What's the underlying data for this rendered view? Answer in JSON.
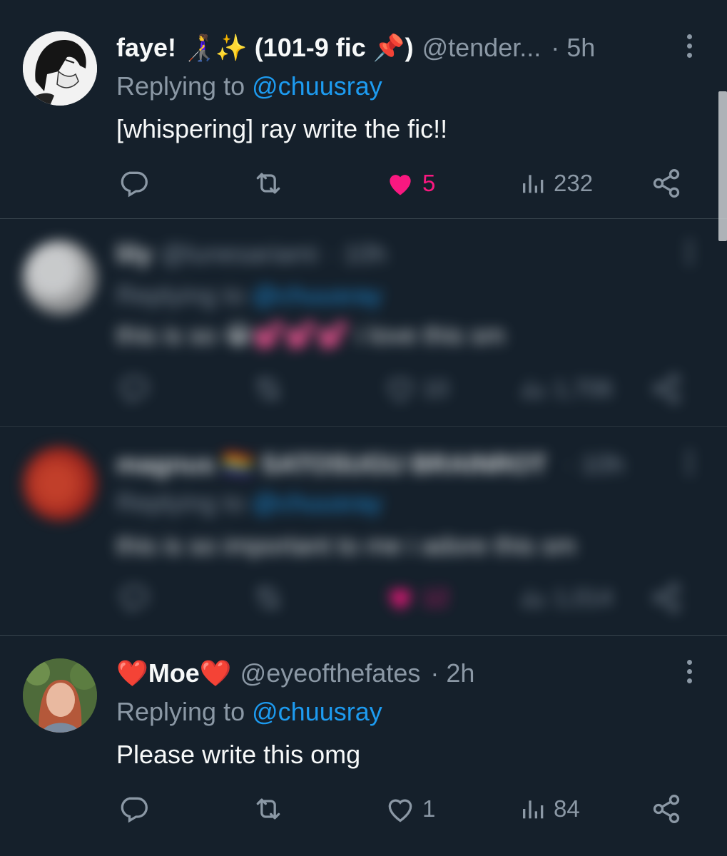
{
  "colors": {
    "background": "#15202b",
    "text": "#f7f9f9",
    "muted": "#8b98a5",
    "link": "#1d9bf0",
    "like": "#f91880"
  },
  "tweets": [
    {
      "name": "faye! 👩‍🦯✨ (101-9 fic 📌)",
      "handle": "@tender...",
      "time": "· 5h",
      "replying_prefix": "Replying to",
      "replying_to": "@chuusray",
      "text": "[whispering] ray write the fic!!",
      "likes": "5",
      "views": "232",
      "liked": true,
      "blurred": false
    },
    {
      "name": "lily",
      "handle": "@lunesariami",
      "time": "· 10h",
      "replying_prefix": "Replying to",
      "replying_to": "@chuusray",
      "text": "this is so 😭💕💕💕 i love this sm",
      "likes": "10",
      "views": "1,706",
      "liked": false,
      "blurred": true
    },
    {
      "name": "magnus 🏳️‍🌈 SATOSUGU BRAINROT",
      "handle": "",
      "time": "· 10h",
      "replying_prefix": "Replying to",
      "replying_to": "@chuusray",
      "text": "this is so important to me i adore this sm",
      "likes": "12",
      "views": "1,014",
      "liked": true,
      "blurred": true
    },
    {
      "name": "❤️Moe❤️",
      "handle": "@eyeofthefates",
      "time": "· 2h",
      "replying_prefix": "Replying to",
      "replying_to": "@chuusray",
      "text": "Please write this omg",
      "likes": "1",
      "views": "84",
      "liked": false,
      "blurred": false
    }
  ],
  "icons": {
    "reply": "reply-icon",
    "retweet": "retweet-icon",
    "like": "heart-icon",
    "views": "views-icon",
    "share": "share-icon",
    "more": "more-icon"
  }
}
